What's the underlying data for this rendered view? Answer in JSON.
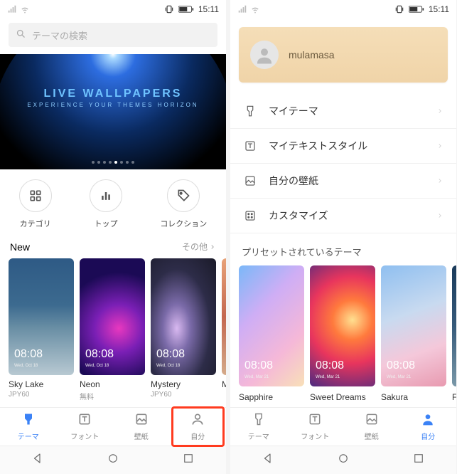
{
  "status": {
    "time": "15:11"
  },
  "search": {
    "placeholder": "テーマの検索"
  },
  "banner": {
    "title": "LIVE WALLPAPERS",
    "subtitle": "EXPERIENCE YOUR THEMES HORIZON"
  },
  "quickcats": {
    "category": "カテゴリ",
    "top": "トップ",
    "collection": "コレクション"
  },
  "section_new": {
    "title": "New",
    "more": "その他"
  },
  "new_themes": [
    {
      "name": "Sky Lake",
      "price": "JPY60",
      "clock": "08:08",
      "date": "Wed, Oct 18"
    },
    {
      "name": "Neon",
      "price": "無料",
      "clock": "08:08",
      "date": "Wed, Oct 18"
    },
    {
      "name": "Mystery",
      "price": "JPY60",
      "clock": "08:08",
      "date": "Wed, Oct 18"
    },
    {
      "name": "M",
      "price": "",
      "clock": "",
      "date": ""
    }
  ],
  "tabs": {
    "theme": "テーマ",
    "font": "フォント",
    "wallpaper": "壁紙",
    "me": "自分"
  },
  "profile": {
    "username": "mulamasa"
  },
  "menu": {
    "my_theme": "マイテーマ",
    "my_textstyle": "マイテキストスタイル",
    "my_wallpaper": "自分の壁紙",
    "customize": "カスタマイズ"
  },
  "preset": {
    "title": "プリセットされているテーマ",
    "items": [
      {
        "name": "Sapphire",
        "clock": "08:08",
        "date": "Wed, Mar 21"
      },
      {
        "name": "Sweet Dreams",
        "clock": "08:08",
        "date": "Wed, Mar 21"
      },
      {
        "name": "Sakura",
        "clock": "08:08",
        "date": "Wed, Mar 21"
      },
      {
        "name": "F",
        "clock": "",
        "date": ""
      }
    ]
  }
}
